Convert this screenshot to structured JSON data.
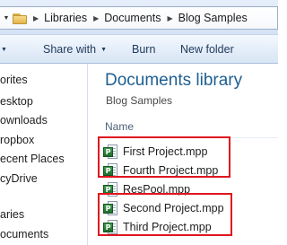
{
  "address_bar": {
    "breadcrumbs": [
      "Libraries",
      "Documents",
      "Blog Samples"
    ]
  },
  "toolbar": {
    "share_with_label": "Share with",
    "burn_label": "Burn",
    "new_folder_label": "New folder"
  },
  "navigation": {
    "items": [
      "orites",
      "esktop",
      "ownloads",
      "ropbox",
      "ecent Places",
      "cyDrive",
      "aries",
      "ocuments"
    ]
  },
  "library": {
    "title": "Documents library",
    "subtitle": "Blog Samples"
  },
  "file_list": {
    "column_name": "Name",
    "files": [
      {
        "name": "First Project.mpp",
        "icon": "ms-project-file-icon",
        "highlighted_group": 1
      },
      {
        "name": "Fourth Project.mpp",
        "icon": "ms-project-file-icon",
        "highlighted_group": 1
      },
      {
        "name": "ResPool.mpp",
        "icon": "ms-project-file-icon",
        "highlighted_group": null
      },
      {
        "name": "Second Project.mpp",
        "icon": "ms-project-file-icon",
        "highlighted_group": 2
      },
      {
        "name": "Third Project.mpp",
        "icon": "ms-project-file-icon",
        "highlighted_group": 2
      }
    ],
    "icon_badge_letter": "P"
  },
  "colors": {
    "library_title": "#1e5f91",
    "highlight_box": "#e0161e",
    "toolbar_text": "#1e395b",
    "project_icon_green": "#2a7d3a"
  }
}
